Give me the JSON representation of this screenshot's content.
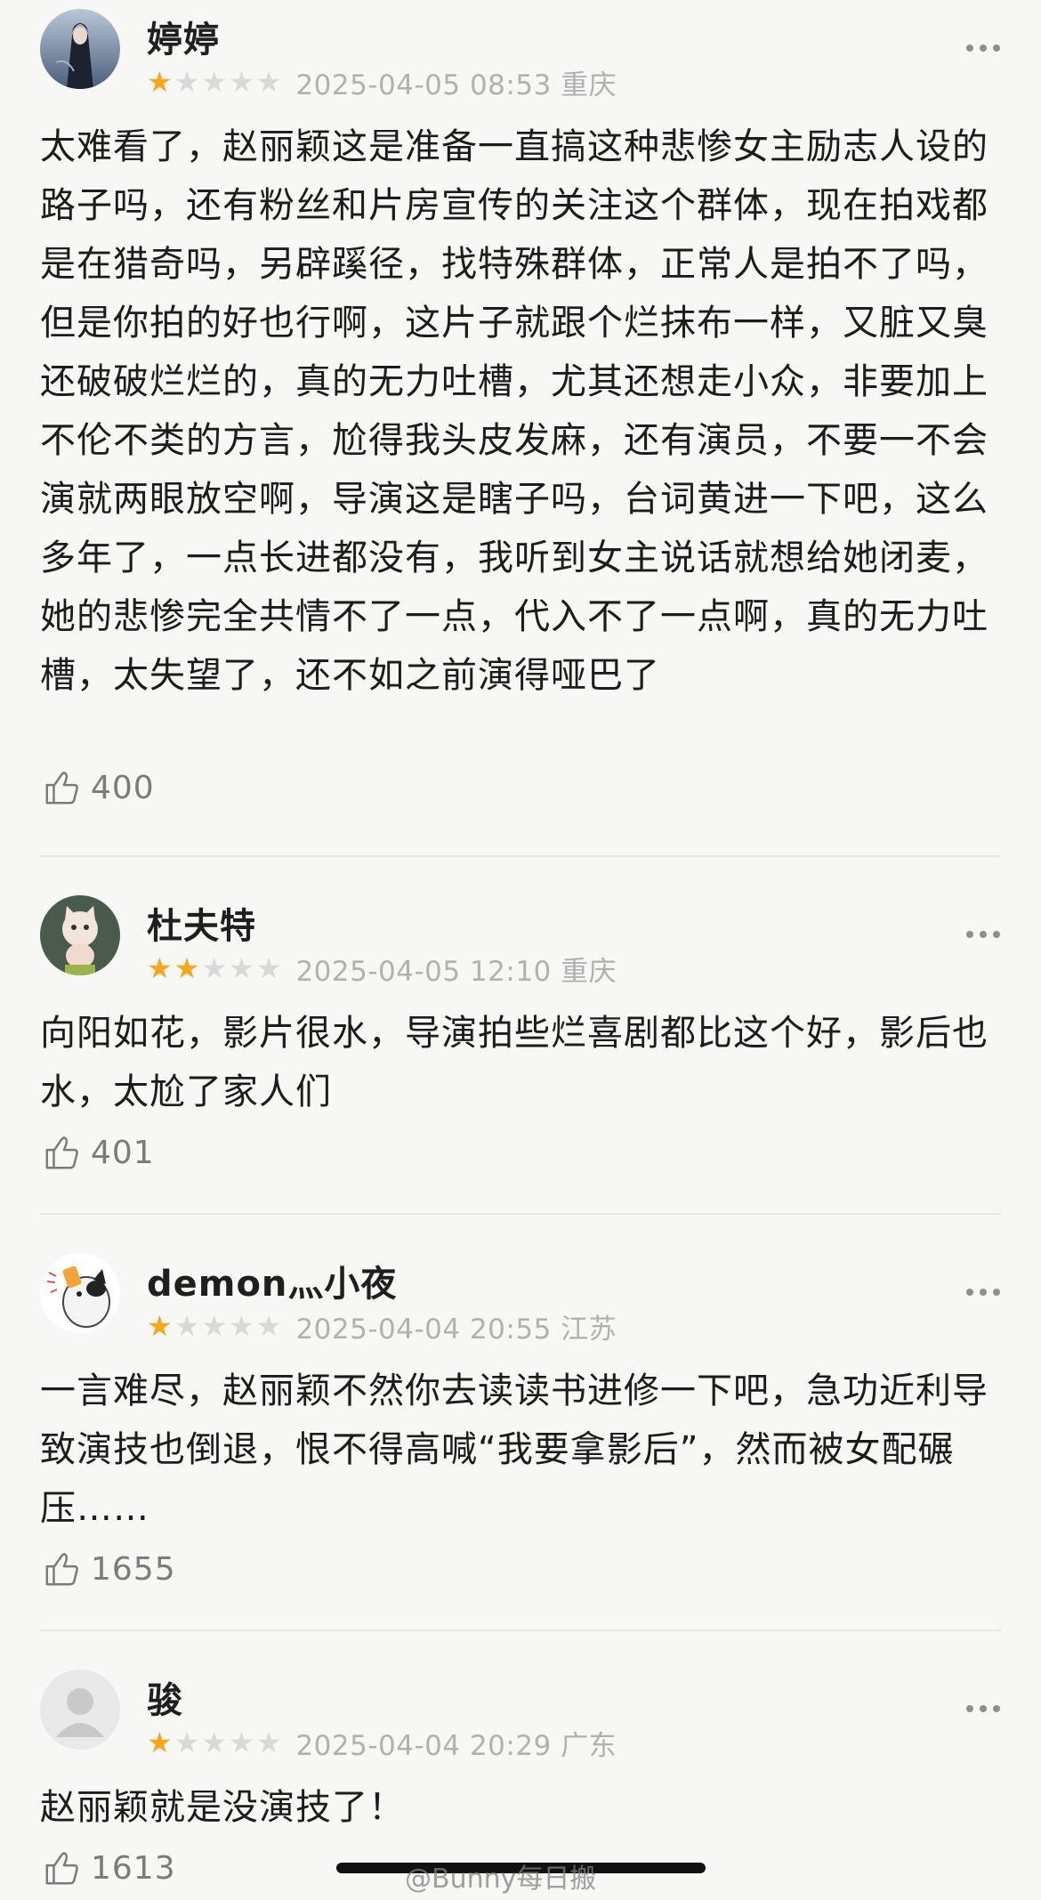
{
  "reviews": [
    {
      "username": "婷婷",
      "rating": 1,
      "meta": "2025-04-05 08:53 重庆",
      "text": "太难看了，赵丽颖这是准备一直搞这种悲惨女主励志人设的路子吗，还有粉丝和片房宣传的关注这个群体，现在拍戏都是在猎奇吗，另辟蹊径，找特殊群体，正常人是拍不了吗，但是你拍的好也行啊，这片子就跟个烂抹布一样，又脏又臭还破破烂烂的，真的无力吐槽，尤其还想走小众，非要加上不伦不类的方言，尬得我头皮发麻，还有演员，不要一不会演就两眼放空啊，导演这是瞎子吗，台词黄进一下吧，这么多年了，一点长进都没有，我听到女主说话就想给她闭麦，她的悲惨完全共情不了一点，代入不了一点啊，真的无力吐槽，太失望了，还不如之前演得哑巴了",
      "likes": "400",
      "avatar_icon": "anime-girl-avatar"
    },
    {
      "username": "杜夫特",
      "rating": 2,
      "meta": "2025-04-05 12:10 重庆",
      "text": "向阳如花，影片很水，导演拍些烂喜剧都比这个好，影后也水，太尬了家人们",
      "likes": "401",
      "avatar_icon": "kitten-avatar"
    },
    {
      "username": "demon灬小夜",
      "rating": 1,
      "meta": "2025-04-04 20:55 江苏",
      "text": "一言难尽，赵丽颖不然你去读读书进修一下吧，急功近利导致演技也倒退，恨不得高喊“我要拿影后”，然而被女配碾压……",
      "likes": "1655",
      "avatar_icon": "cat-avatar"
    },
    {
      "username": "骏",
      "rating": 1,
      "meta": "2025-04-04 20:29 广东",
      "text": "赵丽颖就是没演技了！",
      "likes": "1613",
      "avatar_icon": "default-person-avatar"
    }
  ],
  "watermark": "@Bunny每日搬",
  "colors": {
    "star_on": "#f6a623",
    "star_off": "#d9d9d9",
    "meta": "#b1b1b1",
    "background": "#f7f7f5"
  },
  "icons": [
    "more-dots-icon",
    "thumbs-up-icon",
    "star-icon"
  ]
}
